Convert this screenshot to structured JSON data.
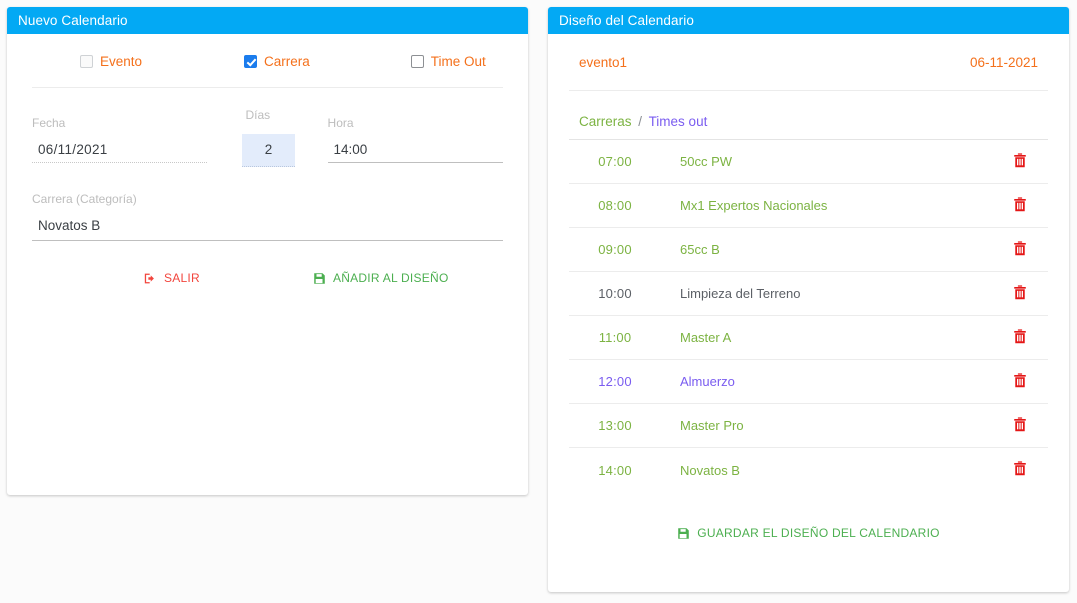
{
  "left_panel": {
    "title": "Nuevo Calendario",
    "checkboxes": [
      {
        "label": "Evento",
        "checked": false,
        "disabled": true,
        "name": "evento"
      },
      {
        "label": "Carrera",
        "checked": true,
        "disabled": false,
        "name": "carrera"
      },
      {
        "label": "Time Out",
        "checked": false,
        "disabled": false,
        "name": "time-out"
      }
    ],
    "fields": {
      "fecha_label": "Fecha",
      "fecha_value": "06/11/2021",
      "dias_label": "Días",
      "dias_value": "2",
      "hora_label": "Hora",
      "hora_value": "14:00",
      "categoria_label": "Carrera (Categoría)",
      "categoria_value": "Novatos B"
    },
    "buttons": {
      "exit_label": "SALIR",
      "exit_icon": "sign-out-icon",
      "exit_color": "#f2453d",
      "add_label": "AÑADIR AL DISEÑO",
      "add_icon": "save-icon",
      "add_color": "#4caf50"
    }
  },
  "right_panel": {
    "title": "Diseño del Calendario",
    "event": {
      "name": "evento1",
      "date": "06-11-2021"
    },
    "tabs": {
      "races_label": "Carreras",
      "separator": "/",
      "timesout_label": "Times out",
      "races_color": "#7cb342",
      "timesout_color": "#7a5cf0"
    },
    "schedule": [
      {
        "time": "07:00",
        "name": "50cc PW",
        "kind": "race"
      },
      {
        "time": "08:00",
        "name": "Mx1 Expertos Nacionales",
        "kind": "race"
      },
      {
        "time": "09:00",
        "name": "65cc B",
        "kind": "race"
      },
      {
        "time": "10:00",
        "name": "Limpieza del Terreno",
        "kind": "neutral"
      },
      {
        "time": "11:00",
        "name": "Master A",
        "kind": "race"
      },
      {
        "time": "12:00",
        "name": "Almuerzo",
        "kind": "timeout"
      },
      {
        "time": "13:00",
        "name": "Master Pro",
        "kind": "race"
      },
      {
        "time": "14:00",
        "name": "Novatos B",
        "kind": "race"
      }
    ],
    "delete_icon": "trash-icon",
    "delete_icon_color": "#e41616",
    "save_button": {
      "label": "GUARDAR EL DISEÑO DEL CALENDARIO",
      "icon": "save-icon",
      "color": "#4caf50"
    }
  },
  "theme": {
    "header_bg": "#03a9f4",
    "accent_orange": "#f4701b",
    "page_bg": "#fbfbfb"
  }
}
